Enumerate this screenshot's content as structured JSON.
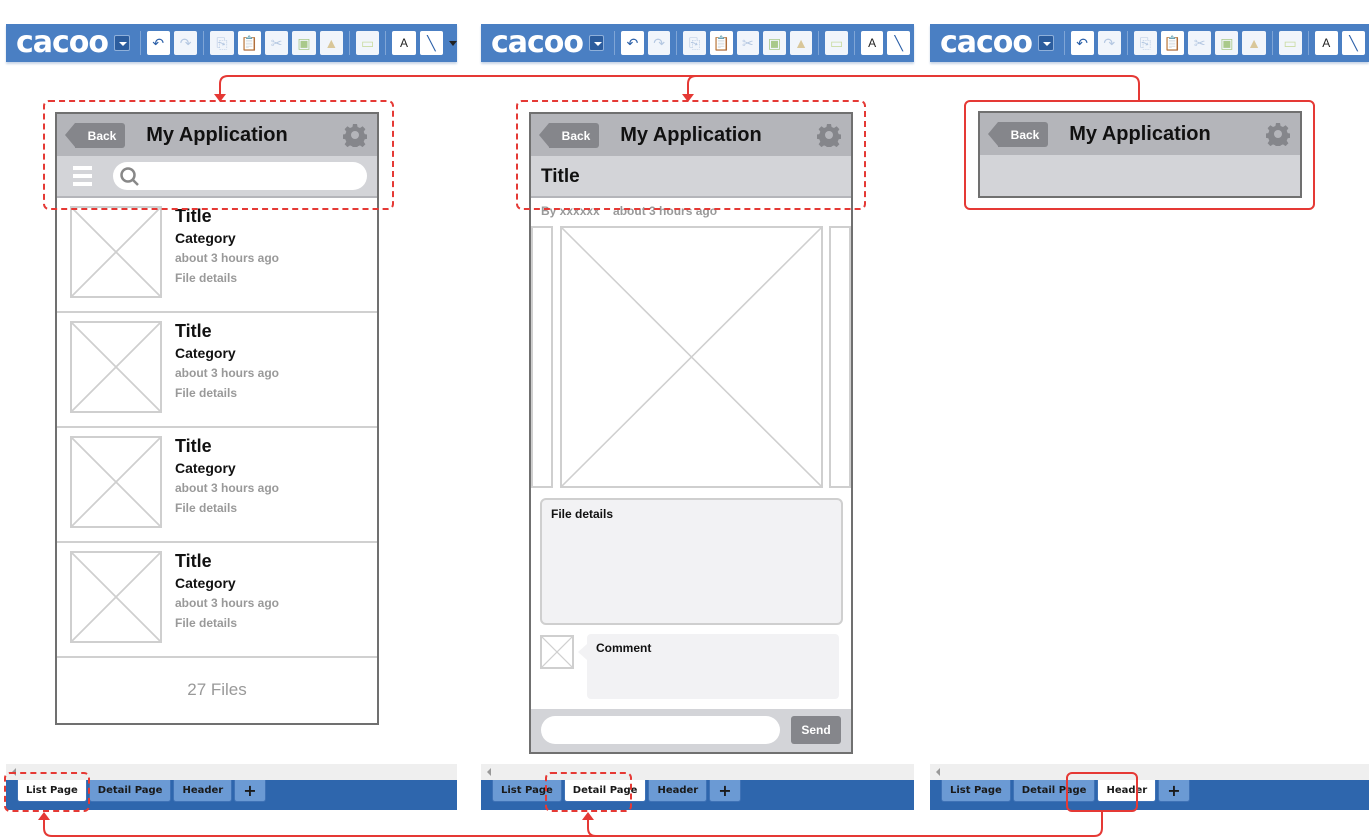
{
  "app": {
    "logo": "cacoo"
  },
  "toolbar": {
    "buttons": [
      {
        "name": "undo",
        "glyph": "↶",
        "enabled": true
      },
      {
        "name": "redo",
        "glyph": "↷",
        "enabled": false
      },
      {
        "name": "copy",
        "glyph": "⎘",
        "enabled": false
      },
      {
        "name": "paste",
        "glyph": "📋",
        "enabled": true
      },
      {
        "name": "cut",
        "glyph": "✂",
        "enabled": false
      },
      {
        "name": "bring-forward",
        "glyph": "▣",
        "enabled": false
      },
      {
        "name": "format-painter",
        "glyph": "▲",
        "enabled": false
      },
      {
        "name": "shape",
        "glyph": "▭",
        "enabled": false
      },
      {
        "name": "text",
        "glyph": "A",
        "enabled": true
      },
      {
        "name": "line",
        "glyph": "╲",
        "enabled": true
      }
    ]
  },
  "sheet_tabs": [
    "List Page",
    "Detail Page",
    "Header"
  ],
  "add_tab_glyph": "+",
  "mockup": {
    "back_label": "Back",
    "app_title": "My Application",
    "list": {
      "items": [
        {
          "title": "Title",
          "category": "Category",
          "time": "about 3 hours ago",
          "details": "File details"
        },
        {
          "title": "Title",
          "category": "Category",
          "time": "about 3 hours ago",
          "details": "File details"
        },
        {
          "title": "Title",
          "category": "Category",
          "time": "about 3 hours ago",
          "details": "File details"
        },
        {
          "title": "Title",
          "category": "Category",
          "time": "about 3 hours ago",
          "details": "File details"
        }
      ],
      "footer": "27 Files"
    },
    "detail": {
      "title": "Title",
      "byline": "By xxxxxx    about 3 hours ago",
      "file_details": "File details",
      "comment": "Comment",
      "send_label": "Send",
      "comment_input_value": ""
    }
  },
  "colors": {
    "accent_red": "#e53935",
    "toolbar_blue": "#4a7fc3",
    "tabbar_blue": "#2e66ad"
  }
}
